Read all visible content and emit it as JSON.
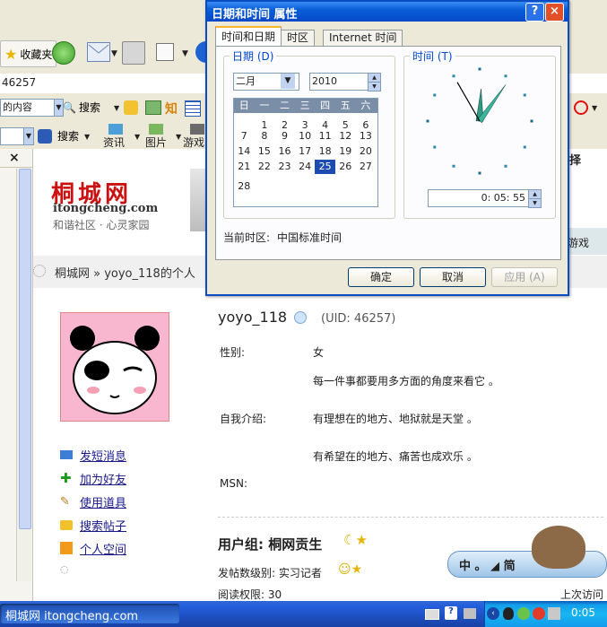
{
  "browser": {
    "toolbar1": {
      "favorites_label": "收藏夹"
    },
    "address_value": "46257",
    "toolbar2": {
      "search_combo_value": "的内容",
      "search_label": "搜索",
      "zhi_label": "知"
    },
    "toolbar3": {
      "search_label": "搜索",
      "info_label": "资讯",
      "pictures_label": "图片",
      "games_label": "游戏"
    },
    "left_panel": {
      "close_glyph": "×"
    }
  },
  "dialog": {
    "title": "日期和时间 属性",
    "help_button": "?",
    "close_button": "×",
    "tabs": [
      "时间和日期",
      "时区",
      "Internet 时间"
    ],
    "date_group_label": "日期 (D)",
    "month_value": "二月",
    "year_value": "2010",
    "time_group_label": "时间 (T)",
    "weekday_headers": [
      "日",
      "一",
      "二",
      "三",
      "四",
      "五",
      "六"
    ],
    "calendar_rows": [
      [
        "",
        "1",
        "2",
        "3",
        "4",
        "5",
        "6"
      ],
      [
        "7",
        "8",
        "9",
        "10",
        "11",
        "12",
        "13"
      ],
      [
        "14",
        "15",
        "16",
        "17",
        "18",
        "19",
        "20"
      ],
      [
        "21",
        "22",
        "23",
        "24",
        "25",
        "26",
        "27"
      ],
      [
        "28",
        "",
        "",
        "",
        "",
        "",
        ""
      ]
    ],
    "selected_day": "25",
    "time_value": "0: 05: 55",
    "clock": {
      "hour": 0,
      "minute": 5,
      "second": 55
    },
    "timezone_label": "当前时区:",
    "timezone_value": "中国标准时间",
    "ok_label": "确定",
    "cancel_label": "取消",
    "apply_label": "应用 (A)"
  },
  "site": {
    "logo_text": "桐城网",
    "logo_domain": "itongcheng.com",
    "logo_slogan": "和谐社区 · 心灵家园",
    "tab_games": "游戏",
    "breadcrumb": "桐城网 » yoyo_118的个人",
    "header_fragment": "择"
  },
  "profile": {
    "username": "yoyo_118",
    "uid": "(UID: 46257)",
    "gender_label": "性别:",
    "gender_value": "女",
    "motto_line1": "每一件事都要用多方面的角度来看它 。",
    "intro_label": "自我介绍:",
    "intro_line1": "有理想在的地方、地狱就是天堂 。",
    "intro_line2": "有希望在的地方、痛苦也成欢乐 。",
    "msn_label": "MSN:",
    "actions": [
      "发短消息",
      "加为好友",
      "使用道具",
      "搜索帖子",
      "个人空间"
    ],
    "group_label": "用户组: 桐网贡生",
    "post_level": "发帖数级别: 实习记者",
    "read_permission": "阅读权限: 30",
    "last_visit": "上次访问",
    "banner_text": "中 。 ◢ 简"
  },
  "taskbar": {
    "window_title": "桐城网 itongcheng.com",
    "clock": "0:05"
  }
}
